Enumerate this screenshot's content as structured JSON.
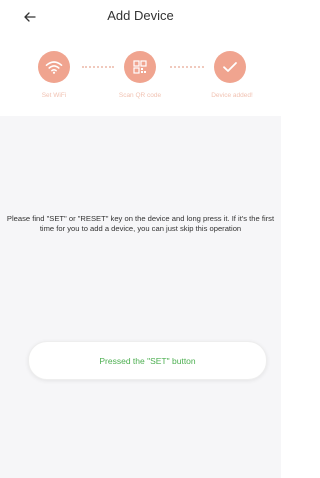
{
  "header": {
    "title": "Add Device"
  },
  "steps": [
    {
      "label": "Set WiFi",
      "icon": "wifi-icon"
    },
    {
      "label": "Scan QR code",
      "icon": "qr-code-icon"
    },
    {
      "label": "Device added!",
      "icon": "checkmark-icon"
    }
  ],
  "instruction": "Please find \"SET\" or \"RESET\" key on the device and long press it. If it's the first time for you to add a device, you can just skip this operation",
  "confirm_button": {
    "label": "Pressed the \"SET\" button"
  },
  "colors": {
    "accent": "#f0a48f",
    "accent_light": "#f1c2b2",
    "button_text": "#4caf50",
    "content_background": "#f6f6f8"
  }
}
